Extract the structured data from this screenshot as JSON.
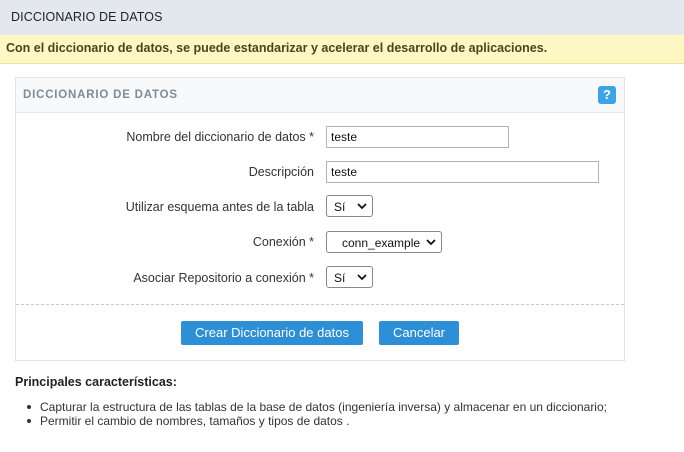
{
  "header": {
    "title": "DICCIONARIO DE DATOS"
  },
  "notice": {
    "text": "Con el diccionario de datos, se puede estandarizar y acelerar el desarrollo de aplicaciones."
  },
  "panel": {
    "title": "DICCIONARIO DE DATOS",
    "help_label": "?",
    "fields": {
      "nombre": {
        "label": "Nombre del diccionario de datos *",
        "value": "teste"
      },
      "descripcion": {
        "label": "Descripción",
        "value": "teste"
      },
      "esquema": {
        "label": "Utilizar esquema antes de la tabla",
        "value": "Sí"
      },
      "conexion": {
        "label": "Conexión *",
        "value": "conn_example"
      },
      "repositorio": {
        "label": "Asociar Repositorio a conexión *",
        "value": "Sí"
      }
    },
    "buttons": {
      "create": "Crear Diccionario de datos",
      "cancel": "Cancelar"
    }
  },
  "features": {
    "title": "Principales características:",
    "items": [
      "Capturar la estructura de las tablas de la base de datos (ingeniería inversa) y almacenar en un diccionario;",
      "Permitir el cambio de nombres, tamaños y tipos de datos ."
    ]
  },
  "colors": {
    "header_bg": "#e3e8ef",
    "notice_bg": "#fdf7c3",
    "button_bg": "#2d8fd5",
    "help_bg": "#3ba3e6"
  }
}
